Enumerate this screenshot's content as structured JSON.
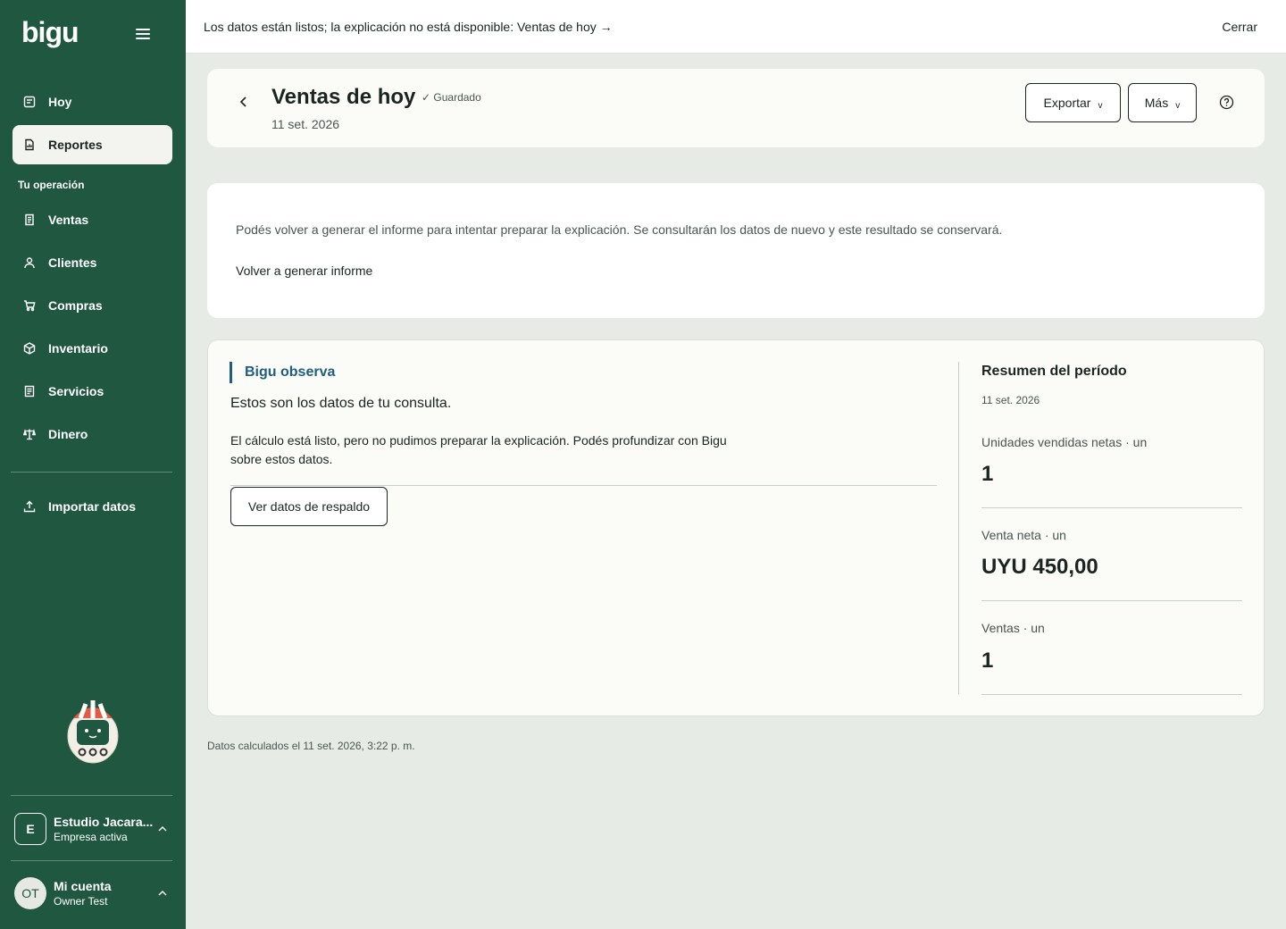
{
  "sidebar": {
    "logo": "bigu",
    "items_top": [
      {
        "label": "Hoy",
        "icon": "today-icon"
      },
      {
        "label": "Reportes",
        "icon": "reports-icon"
      }
    ],
    "section_label": "Tu operación",
    "items_op": [
      {
        "label": "Ventas",
        "icon": "receipt-icon"
      },
      {
        "label": "Clientes",
        "icon": "user-icon"
      },
      {
        "label": "Compras",
        "icon": "cart-icon"
      },
      {
        "label": "Inventario",
        "icon": "box-icon"
      },
      {
        "label": "Servicios",
        "icon": "document-icon"
      },
      {
        "label": "Dinero",
        "icon": "scale-icon"
      }
    ],
    "import_label": "Importar datos",
    "company": {
      "initial": "E",
      "name": "Estudio Jacara...",
      "status": "Empresa activa"
    },
    "account": {
      "initials": "OT",
      "title": "Mi cuenta",
      "name": "Owner Test"
    }
  },
  "banner": {
    "text": "Los datos están listos; la explicación no está disponible: Ventas de hoy →",
    "close": "Cerrar"
  },
  "header": {
    "title": "Ventas de hoy",
    "saved": "✓ Guardado",
    "date": "11 set. 2026",
    "export": "Exportar",
    "more": "Más"
  },
  "notice": {
    "text": "Podés volver a generar el informe para intentar preparar la explicación. Se consultarán los datos de nuevo y este resultado se conservará.",
    "action": "Volver a generar informe"
  },
  "observation": {
    "title": "Bigu observa",
    "subtitle": "Estos son los datos de tu consulta.",
    "body": "El cálculo está listo, pero no pudimos preparar la explicación. Podés profundizar con Bigu sobre estos datos.",
    "button": "Ver datos de respaldo"
  },
  "summary": {
    "title": "Resumen del período",
    "date": "11 set. 2026",
    "metrics": [
      {
        "label": "Unidades vendidas netas · un",
        "value": "1"
      },
      {
        "label": "Venta neta · un",
        "value": "UYU 450,00"
      },
      {
        "label": "Ventas · un",
        "value": "1"
      }
    ]
  },
  "footer": "Datos calculados el 11 set. 2026, 3:22 p. m.",
  "colors": {
    "sidebar": "#1f5740",
    "accent": "#205d80",
    "background": "#e7ebe6"
  }
}
